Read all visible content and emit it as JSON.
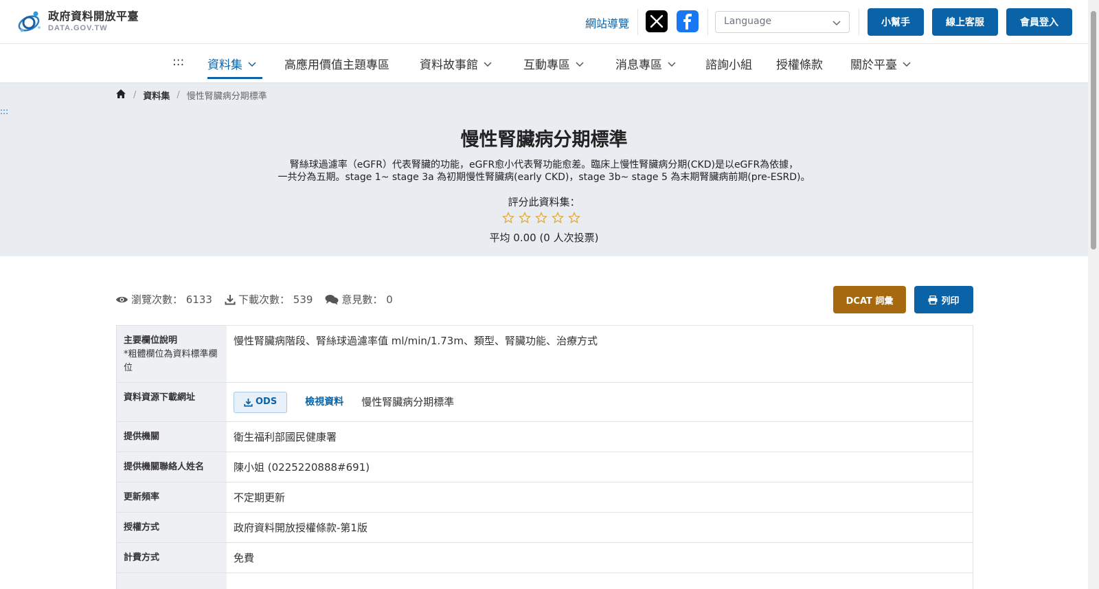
{
  "header": {
    "logo_title": "政府資料開放平臺",
    "logo_sub": "DATA.GOV.TW",
    "sitemap": "網站導覽",
    "language_placeholder": "Language",
    "help_btn": "小幫手",
    "cs_btn": "線上客服",
    "login_btn": "會員登入"
  },
  "nav": {
    "access_key": ":::",
    "items": [
      "資料集",
      "高應用價值主題專區",
      "資料故事館",
      "互動專區",
      "消息專區",
      "諮詢小組",
      "授權條款",
      "關於平臺"
    ]
  },
  "breadcrumb": {
    "level1": "資料集",
    "current": "慢性腎臟病分期標準"
  },
  "hero": {
    "access_key": ":::",
    "title": "慢性腎臟病分期標準",
    "desc_line1": "腎絲球過濾率（eGFR）代表腎臟的功能，eGFR愈小代表腎功能愈差。臨床上慢性腎臟病分期(CKD)是以eGFR為依據，",
    "desc_line2": "一共分為五期。stage 1~ stage 3a 為初期慢性腎臟病(early CKD)，stage 3b~ stage 5 為末期腎臟病前期(pre-ESRD)。",
    "rate_label": "評分此資料集：",
    "rating": 0,
    "rating_max": 5,
    "avg": "平均 0.00 (0 人次投票)"
  },
  "stats": {
    "views_label": "瀏覽次數：",
    "views": "6133",
    "downloads_label": "下載次數：",
    "downloads": "539",
    "comments_label": "意見數：",
    "comments": "0",
    "dcat_btn": "DCAT 詞彙",
    "print_btn": "列印"
  },
  "table": {
    "r1_label": "主要欄位說明",
    "r1_note": "*粗體欄位為資料標準欄位",
    "r1_value": "慢性腎臟病階段、腎絲球過濾率值 ml/min/1.73m、類型、腎臟功能、治療方式",
    "r2_label": "資料資源下載網址",
    "r2_btn": "ODS",
    "r2_view": "檢視資料",
    "r2_name": "慢性腎臟病分期標準",
    "r3_label": "提供機關",
    "r3_value": "衛生福利部國民健康署",
    "r4_label": "提供機關聯絡人姓名",
    "r4_value": "陳小姐 (0225220888#691)",
    "r5_label": "更新頻率",
    "r5_value": "不定期更新",
    "r6_label": "授權方式",
    "r6_value": "政府資料開放授權條款-第1版",
    "r7_label": "計費方式",
    "r7_value": "免費"
  },
  "colors": {
    "primary": "#0a63a7",
    "dcat": "#a6690f",
    "star": "#e0a82e",
    "hero_bg": "#e9ecf1"
  }
}
